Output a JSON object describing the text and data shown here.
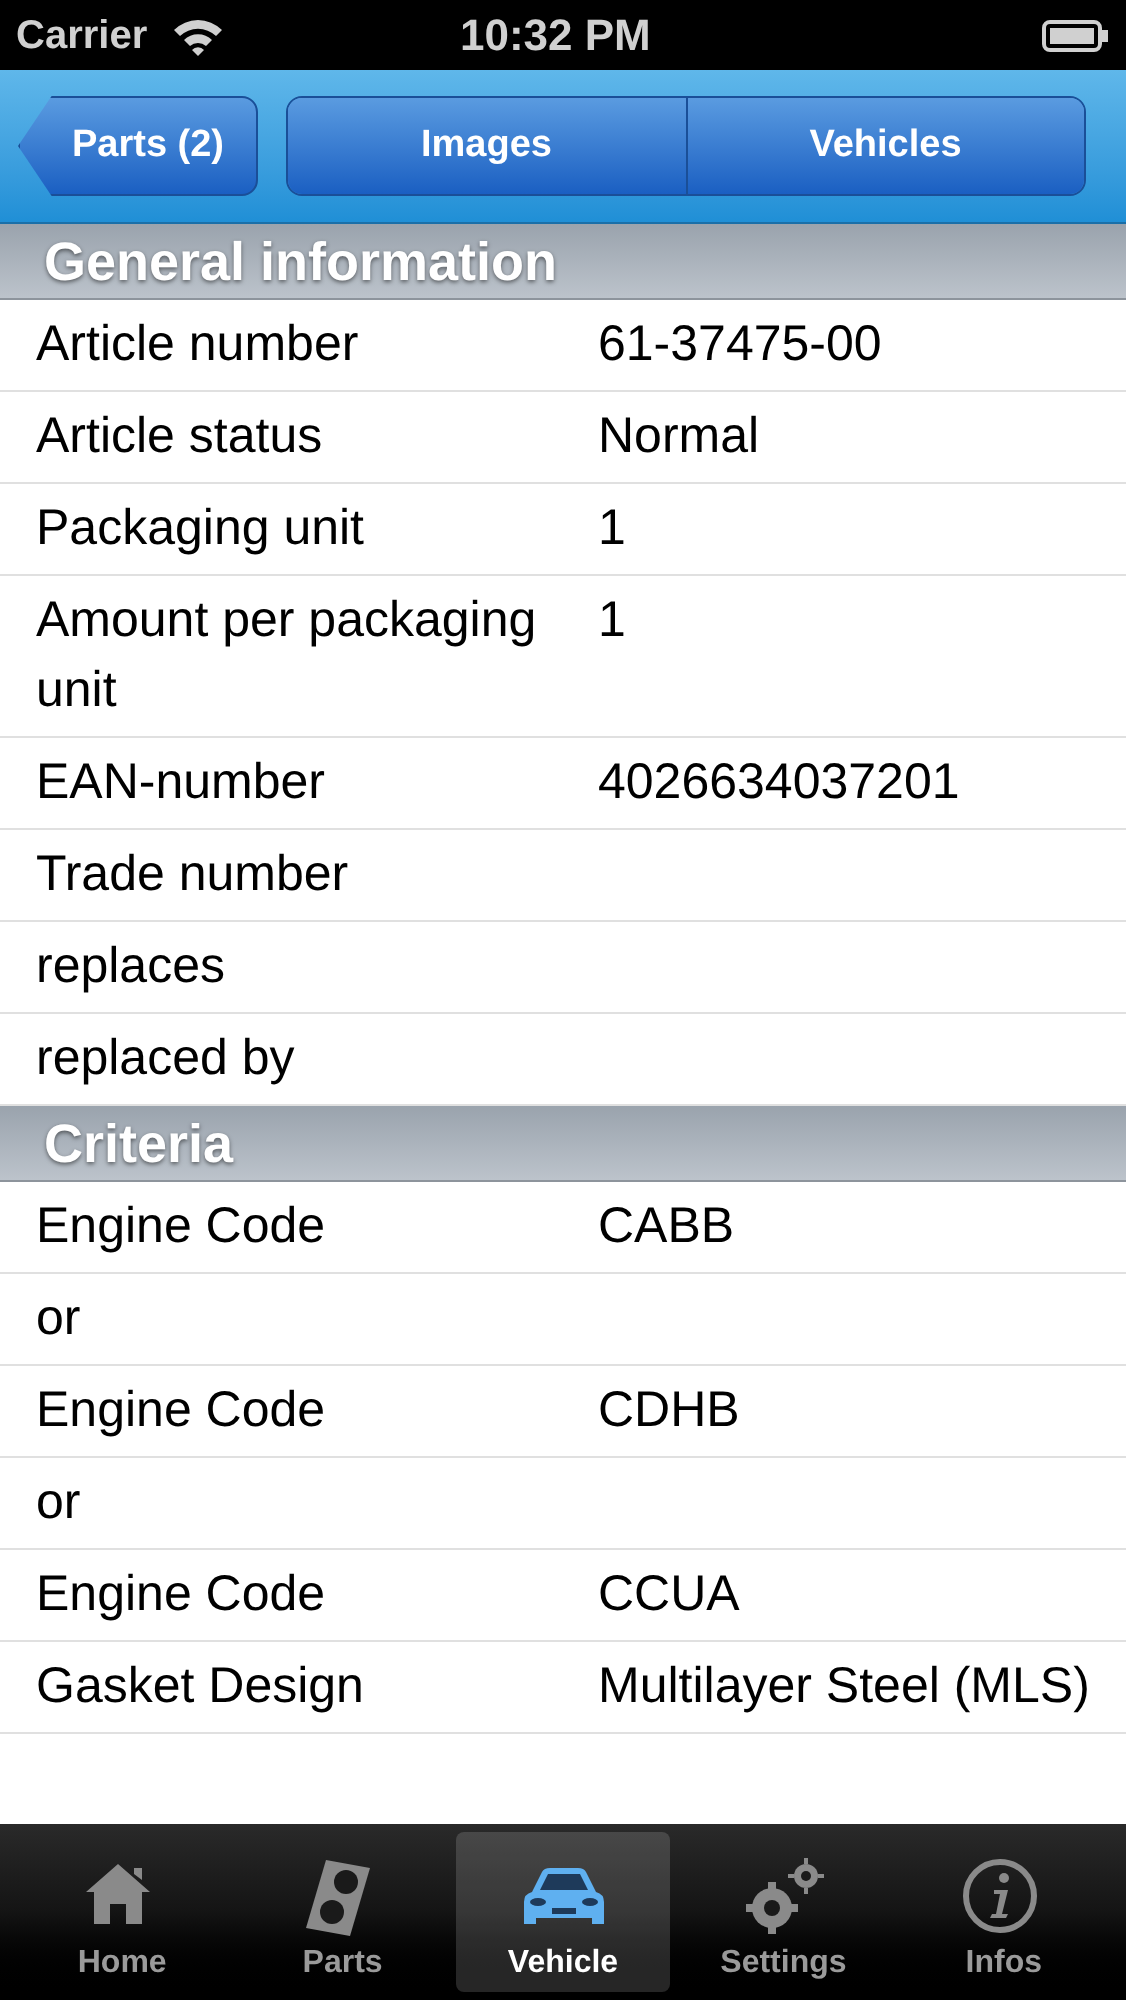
{
  "status_bar": {
    "carrier": "Carrier",
    "time": "10:32 PM"
  },
  "nav_bar": {
    "back_button": "Parts (2)",
    "segments": [
      "Images",
      "Vehicles"
    ]
  },
  "sections": [
    {
      "title": "General information",
      "rows": [
        {
          "label": "Article number",
          "value": "61-37475-00"
        },
        {
          "label": "Article status",
          "value": "Normal"
        },
        {
          "label": "Packaging unit",
          "value": "1"
        },
        {
          "label": "Amount per packaging unit",
          "value": "1"
        },
        {
          "label": "EAN-number",
          "value": "4026634037201"
        },
        {
          "label": "Trade number"
        },
        {
          "label": "replaces"
        },
        {
          "label": "replaced by"
        }
      ]
    },
    {
      "title": "Criteria",
      "rows": [
        {
          "label": "Engine Code",
          "value": "CABB"
        },
        {
          "label": "or"
        },
        {
          "label": "Engine Code",
          "value": "CDHB"
        },
        {
          "label": "or"
        },
        {
          "label": "Engine Code",
          "value": "CCUA"
        },
        {
          "label": "Gasket Design",
          "value": "Multilayer Steel (MLS)"
        }
      ]
    }
  ],
  "tab_bar": [
    {
      "kind": "home",
      "label": "Home",
      "selected": false
    },
    {
      "kind": "parts",
      "label": "Parts",
      "selected": false
    },
    {
      "kind": "vehicle",
      "label": "Vehicle",
      "selected": true
    },
    {
      "kind": "settings",
      "label": "Settings",
      "selected": false
    },
    {
      "kind": "infos",
      "label": "Infos",
      "selected": false
    }
  ]
}
